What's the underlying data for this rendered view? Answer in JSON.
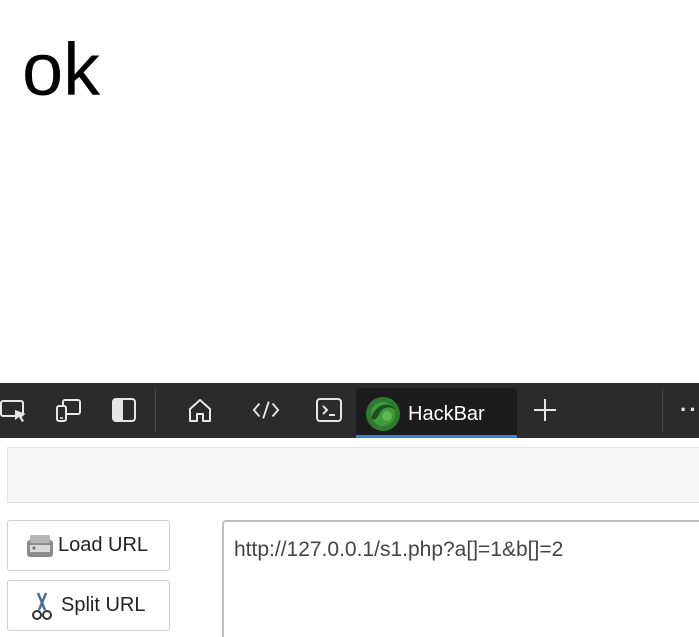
{
  "page": {
    "content_text": "ok"
  },
  "devtools": {
    "active_tab": "HackBar",
    "accent_color": "#3b82d6",
    "icons": [
      "inspect-icon",
      "device-emulation-icon",
      "dock-sidebar-icon",
      "home-icon",
      "elements-icon",
      "console-icon",
      "add-tab-icon",
      "more-icon"
    ],
    "more_label": "··"
  },
  "hackbar": {
    "load_url_label": "Load URL",
    "split_url_label": "Split URL",
    "url_value": "http://127.0.0.1/s1.php?a[]=1&b[]=2"
  }
}
